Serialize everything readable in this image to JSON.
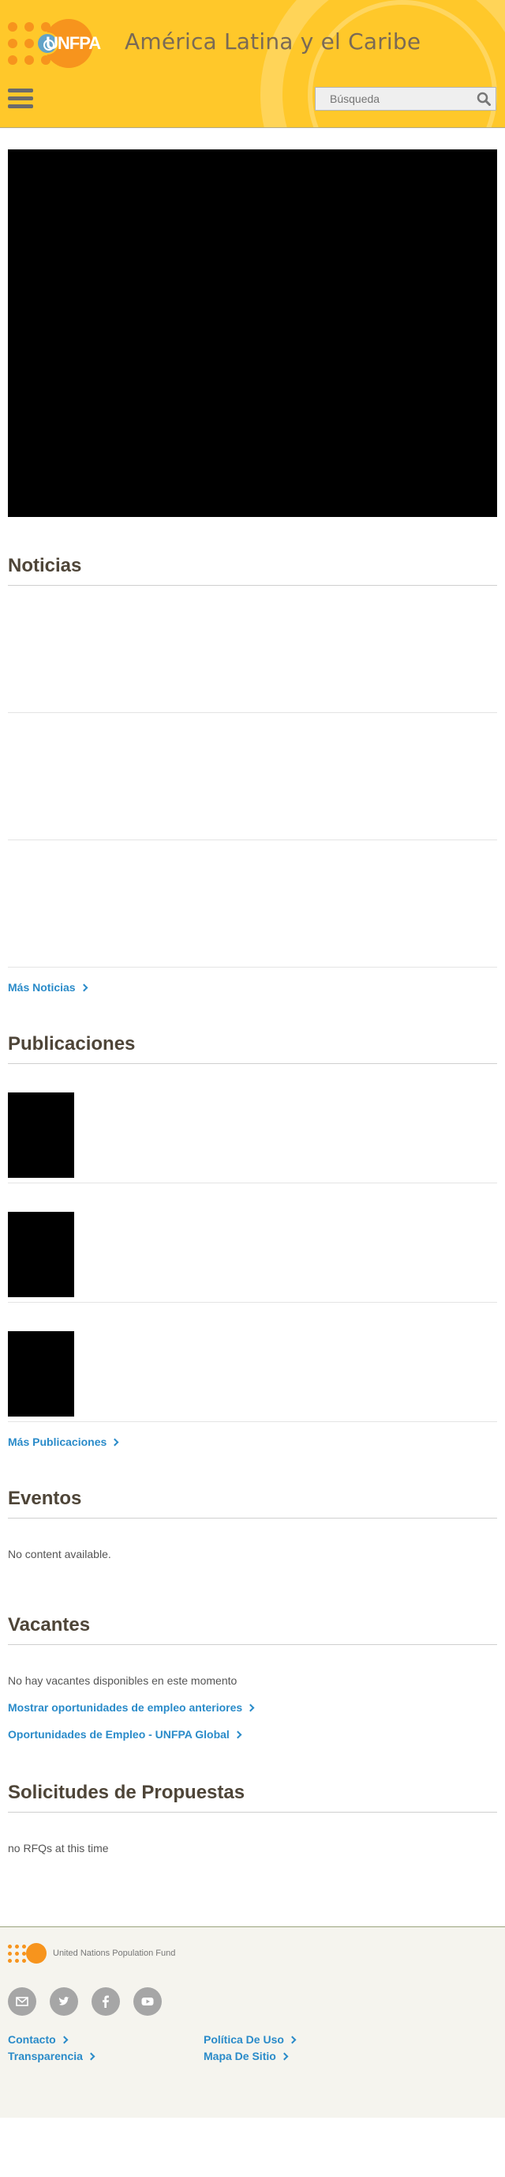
{
  "header": {
    "logo_text": "UNFPA",
    "region_title": "América Latina y el Caribe",
    "search_placeholder": "Búsqueda",
    "menu_icon": "hamburger-menu-icon",
    "search_icon": "magnifier-icon"
  },
  "sections": {
    "noticias": {
      "title": "Noticias",
      "more_label": "Más Noticias"
    },
    "publicaciones": {
      "title": "Publicaciones",
      "more_label": "Más Publicaciones"
    },
    "eventos": {
      "title": "Eventos",
      "empty_text": "No content available."
    },
    "vacantes": {
      "title": "Vacantes",
      "empty_text": "No hay vacantes disponibles en este momento",
      "link_previous": "Mostrar oportunidades de empleo anteriores",
      "link_global": "Oportunidades de Empleo - UNFPA Global"
    },
    "solicitudes": {
      "title": "Solicitudes de Propuestas",
      "empty_text": "no RFQs at this time"
    }
  },
  "footer": {
    "org_name": "United Nations Population Fund",
    "social": [
      "email-icon",
      "twitter-icon",
      "facebook-icon",
      "youtube-icon"
    ],
    "links": {
      "contacto": "Contacto",
      "politica": "Política De Uso",
      "transparencia": "Transparencia",
      "mapa": "Mapa De Sitio"
    }
  },
  "colors": {
    "header_bg": "#ffc82a",
    "accent_orange": "#f7941d",
    "link_blue": "#2a8bc9",
    "heading_brown": "#4e4538"
  }
}
